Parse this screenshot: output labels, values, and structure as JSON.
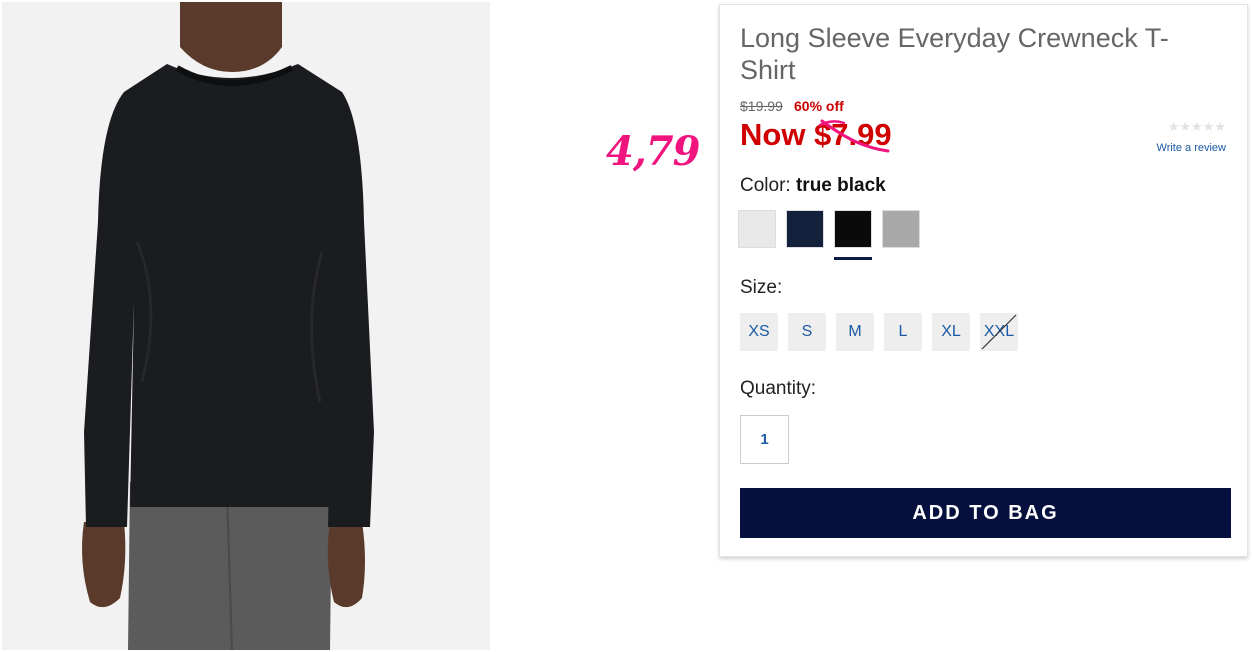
{
  "annotation": {
    "handwritten_price": "4,79",
    "color": "#f0147e"
  },
  "product": {
    "title": "Long Sleeve Everyday Crewneck T-Shirt",
    "original_price": "$19.99",
    "percent_off": "60% off",
    "now_price": "Now $7.99",
    "rating": {
      "stars": "★★★★★",
      "filled": 0,
      "max": 5,
      "review_link": "Write a review"
    }
  },
  "color": {
    "label": "Color:",
    "selected": "true black",
    "swatches": [
      {
        "name": "white",
        "hex": "#e8e8e8"
      },
      {
        "name": "navy",
        "hex": "#14213d"
      },
      {
        "name": "true black",
        "hex": "#0a0a0a",
        "selected": true
      },
      {
        "name": "heather grey",
        "hex": "#a9a9a9"
      }
    ]
  },
  "size": {
    "label": "Size:",
    "options": [
      "XS",
      "S",
      "M",
      "L",
      "XL",
      "XXL"
    ],
    "unavailable": [
      "XXL"
    ]
  },
  "quantity": {
    "label": "Quantity:",
    "value": "1"
  },
  "cta": {
    "add_to_bag": "ADD TO BAG"
  },
  "colors": {
    "sale_red": "#d00000",
    "navy_button": "#05103f",
    "link_blue": "#1b5aa6"
  }
}
